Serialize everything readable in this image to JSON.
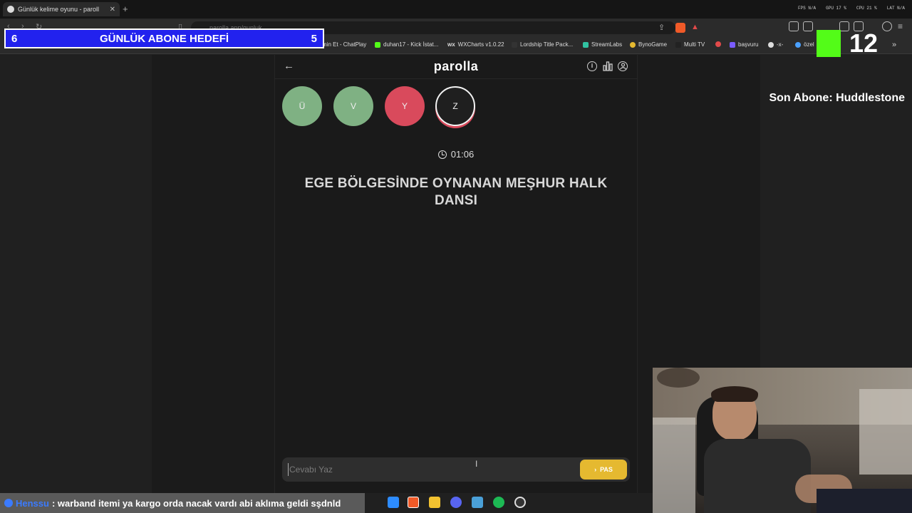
{
  "browser": {
    "tab_title": "Günlük kelime oyunu - paroll",
    "url": "parolla.app/gunluk",
    "stats": [
      "FPS N/A",
      "GPU 17 %",
      "CPU 21 %",
      "LAT N/A"
    ],
    "bookmarks": [
      "min Et - ChatPlay",
      "duhan17 - Kick İstat...",
      "WXCharts v1.0.22",
      "Lordship Title Pack...",
      "StreamLabs",
      "BynoGame",
      "Multi TV",
      "başvuru",
      "-x-",
      "özel"
    ]
  },
  "app": {
    "logo": "parolla",
    "letters": [
      {
        "char": "Ü",
        "state": "correct",
        "color": "#7fb183"
      },
      {
        "char": "V",
        "state": "correct",
        "color": "#7fb183"
      },
      {
        "char": "Y",
        "state": "wrong",
        "color": "#d94a5c"
      },
      {
        "char": "Z",
        "state": "active",
        "color": "#1f1f1f"
      }
    ],
    "timer": "01:06",
    "question": "EGE BÖLGESİNDE OYNANAN MEŞHUR HALK DANSI",
    "answer_placeholder": "Cevabı Yaz",
    "answer_value": "",
    "pass_label": "PAS"
  },
  "overlay": {
    "goal_left": "6",
    "goal_title": "GÜNLÜK ABONE HEDEFİ",
    "goal_right": "5",
    "kick_count": "12",
    "last_sub": "Son Abone: Huddlestone",
    "chat_user": "Henssu",
    "chat_message": ": warband itemi ya kargo orda nacak vardı abi aklıma geldi sşdnld"
  },
  "colors": {
    "correct": "#7fb183",
    "wrong": "#d94a5c",
    "pass": "#e5b930",
    "goal_bg": "#2222ee",
    "kick_green": "#53fc18"
  }
}
